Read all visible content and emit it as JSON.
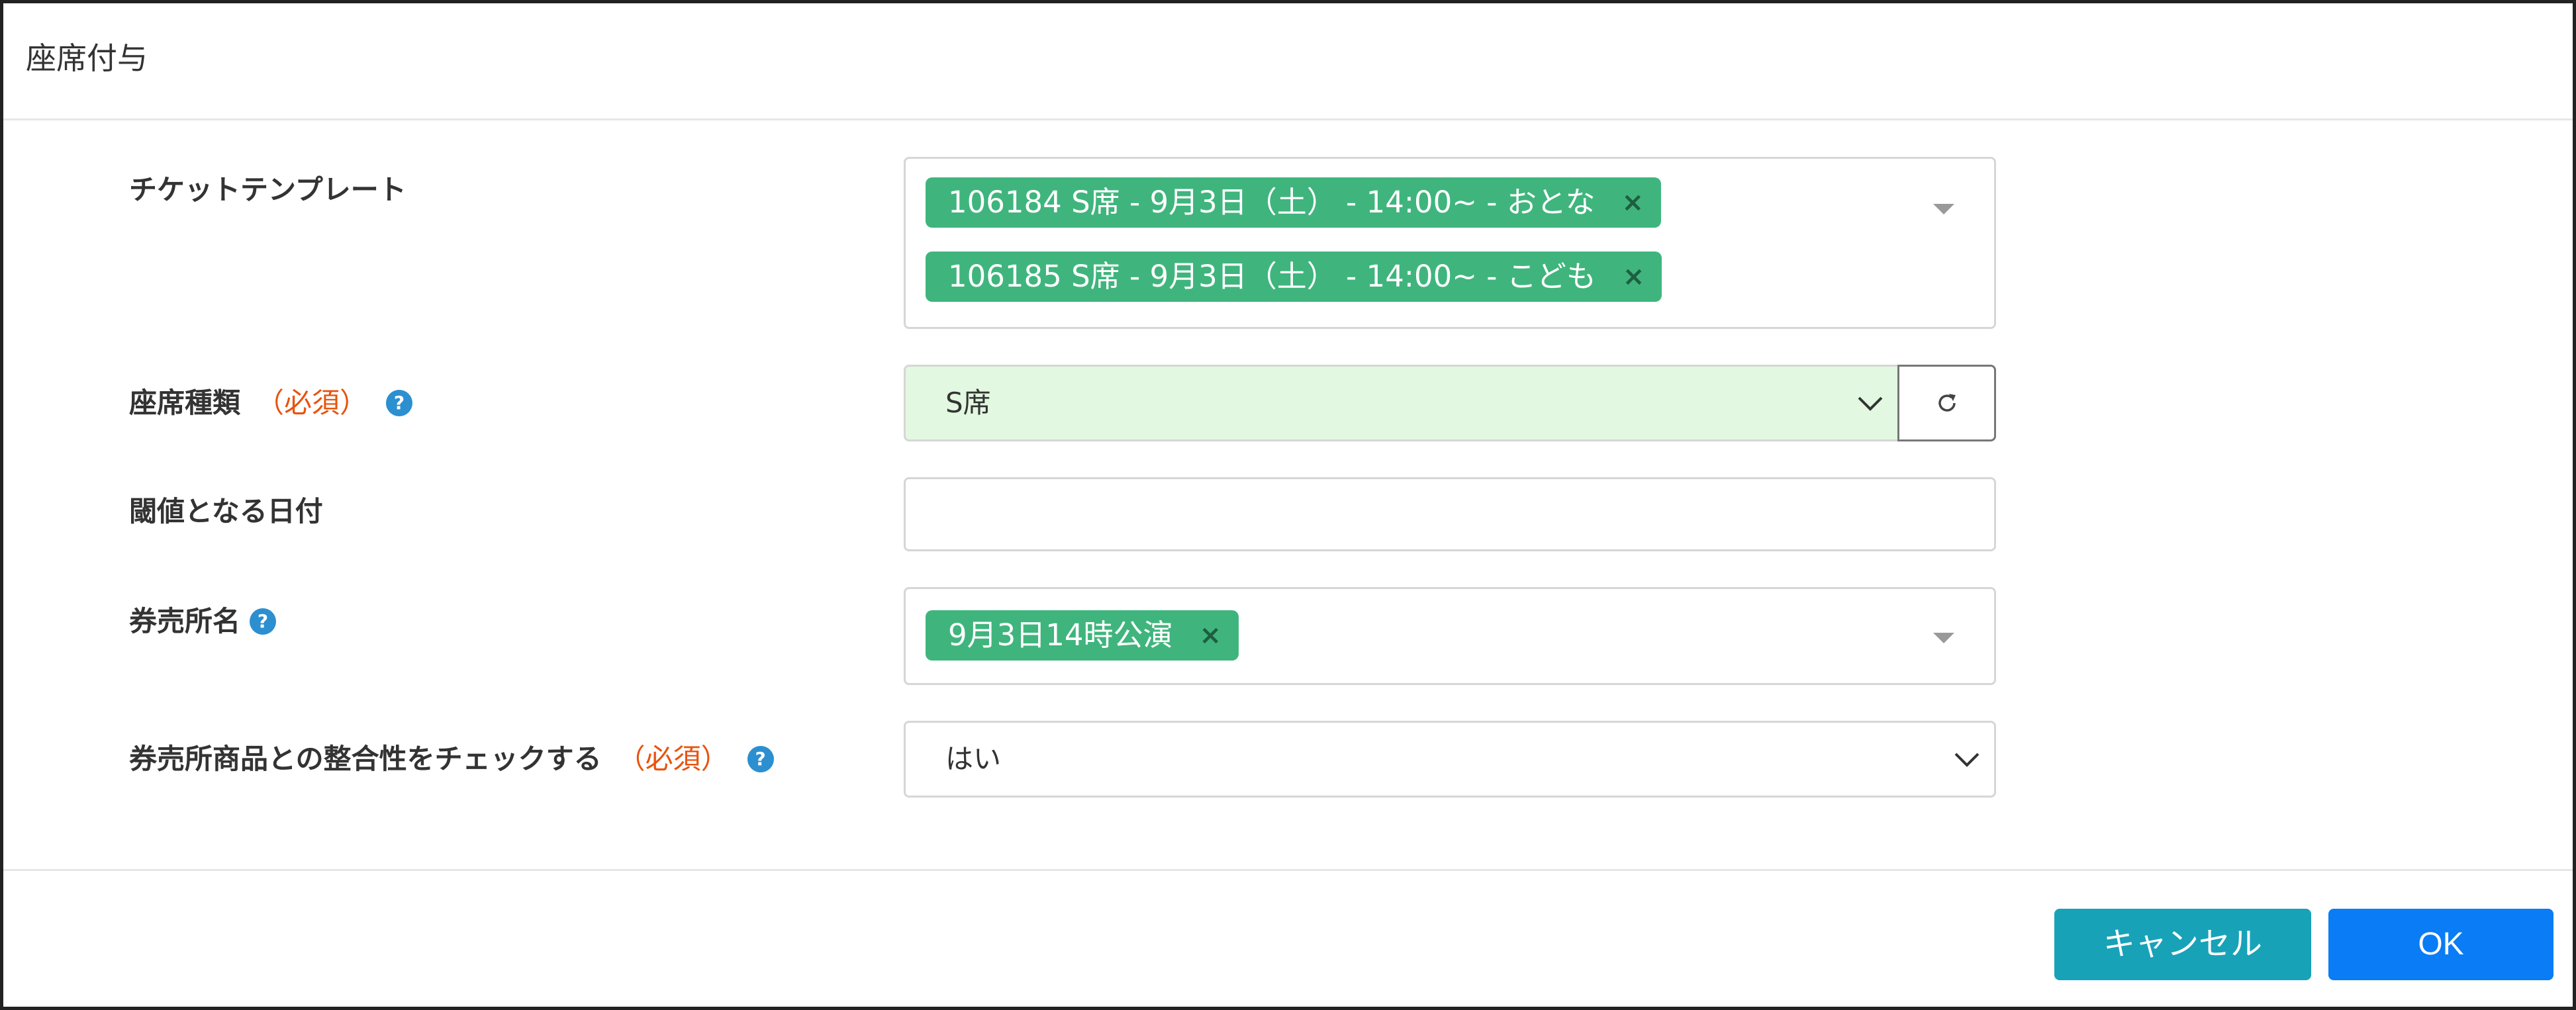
{
  "modal": {
    "title": "座席付与"
  },
  "fields": {
    "ticket_template": {
      "label": "チケットテンプレート",
      "tags": [
        "106184 S席 - 9月3日（土） - 14:00~ - おとな",
        "106185 S席 - 9月3日（土） - 14:00~ - こども"
      ],
      "remove_glyph": "×"
    },
    "seat_type": {
      "label": "座席種類",
      "required": "（必須）",
      "help_glyph": "?",
      "value": "S席",
      "bg_color": "#e2f8e0"
    },
    "threshold_date": {
      "label": "閾値となる日付",
      "value": ""
    },
    "ticket_office_name": {
      "label": "券売所名",
      "help_glyph": "?",
      "tags": [
        "9月3日14時公演"
      ],
      "remove_glyph": "×"
    },
    "check_consistency": {
      "label": "券売所商品との整合性をチェックする",
      "required": "（必須）",
      "help_glyph": "?",
      "value": "はい"
    }
  },
  "footer": {
    "cancel_label": "キャンセル",
    "ok_label": "OK"
  },
  "colors": {
    "tag_green": "#3fb57d",
    "required_orange": "#e8530e",
    "help_blue": "#2b8fd0",
    "cancel_teal": "#18a2b8",
    "ok_blue": "#0a7cf5"
  }
}
